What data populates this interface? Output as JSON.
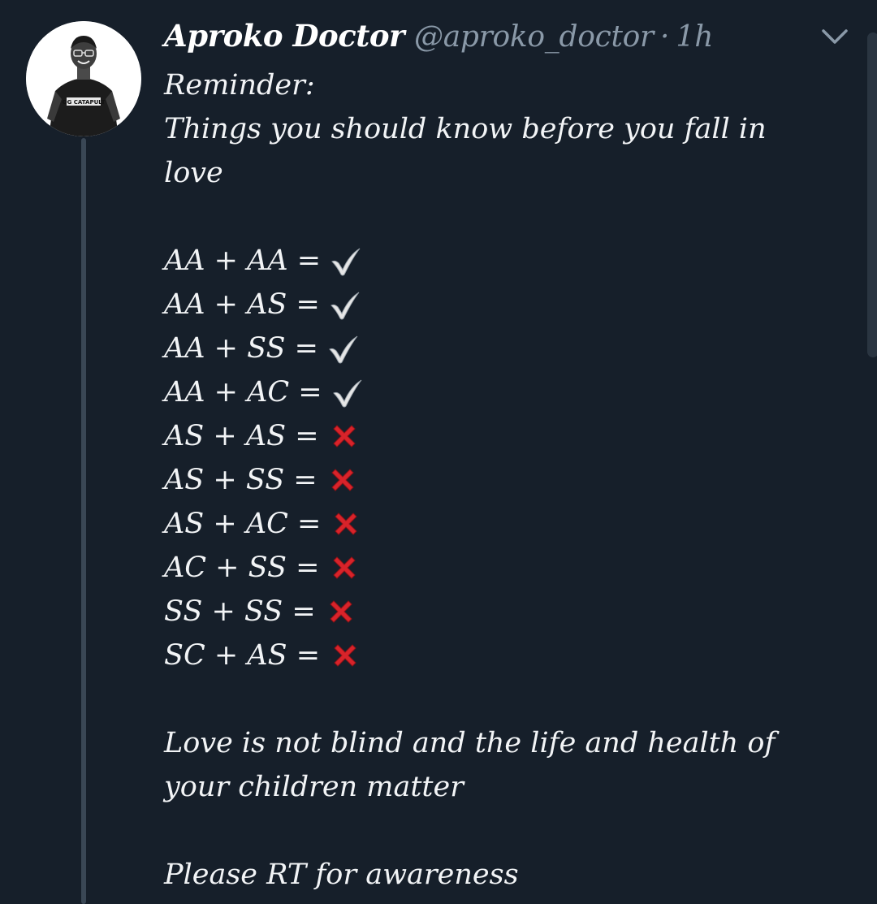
{
  "tweet": {
    "author_name": "Aproko Doctor",
    "author_handle": "@aproko_doctor",
    "separator": "·",
    "time": "1h",
    "avatar_shirt_text": "OG CATAPULT",
    "intro_line1": "Reminder:",
    "intro_line2": "Things you should know before you fall in love",
    "combos": [
      {
        "text": "AA + AA =",
        "result": "check"
      },
      {
        "text": "AA + AS =",
        "result": "check"
      },
      {
        "text": "AA + SS =",
        "result": "check"
      },
      {
        "text": "AA + AC =",
        "result": "check"
      },
      {
        "text": "AS + AS =",
        "result": "cross"
      },
      {
        "text": "AS + SS =",
        "result": "cross"
      },
      {
        "text": "AS + AC =",
        "result": "cross"
      },
      {
        "text": "AC + SS =",
        "result": "cross"
      },
      {
        "text": "SS + SS =",
        "result": "cross"
      },
      {
        "text": "SC + AS =",
        "result": "cross"
      }
    ],
    "closing": "Love is not blind and the life and health of your children matter",
    "cta": "Please RT for awareness"
  },
  "icons": {
    "check": "check-mark-icon",
    "cross": "cross-mark-icon",
    "menu": "chevron-down-icon"
  },
  "colors": {
    "background": "#161f2a",
    "text": "#f2f4f6",
    "secondary_text": "#8a99a8",
    "cross": "#d8232a",
    "check": "#e6e6e6"
  }
}
